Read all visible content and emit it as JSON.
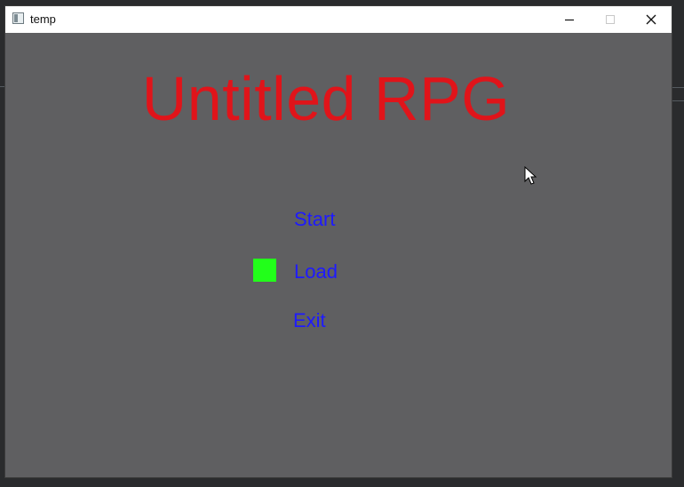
{
  "window": {
    "title": "temp",
    "controls": {
      "minimize_icon": "minimize-icon",
      "maximize_icon": "maximize-icon",
      "close_icon": "close-icon"
    }
  },
  "game": {
    "title": "Untitled RPG",
    "menu": {
      "items": [
        {
          "label": "Start"
        },
        {
          "label": "Load"
        },
        {
          "label": "Exit"
        }
      ],
      "selected_label": "Load"
    }
  },
  "colors": {
    "background": "#5f5f61",
    "title": "#e0141a",
    "menu_text": "#1e1aff",
    "selector": "#22ff1a"
  }
}
